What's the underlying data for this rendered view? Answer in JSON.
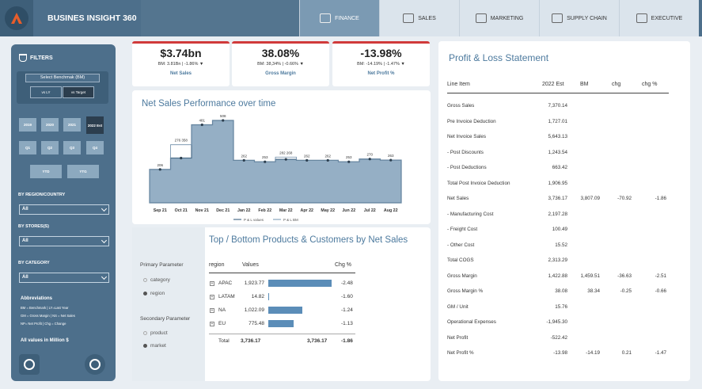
{
  "app": {
    "title": "BUSINES INSIGHT 360"
  },
  "nav": [
    {
      "label": "FINANCE",
      "icon": "finance-icon",
      "active": true
    },
    {
      "label": "SALES",
      "icon": "sales-icon",
      "active": false
    },
    {
      "label": "MARKETING",
      "icon": "marketing-icon",
      "active": false
    },
    {
      "label": "SUPPLY CHAIN",
      "icon": "supply-chain-icon",
      "active": false
    },
    {
      "label": "EXECUTIVE",
      "icon": "executive-icon",
      "active": false
    }
  ],
  "sidebar": {
    "filters_label": "FILTERS",
    "benchmark_title": "Select Benchmak (BM)",
    "bm_options": [
      "vs LY",
      "vs Target"
    ],
    "bm_selected": "vs Target",
    "years": [
      "2019",
      "2020",
      "2021",
      "2022 Est"
    ],
    "year_selected": "2022 Est",
    "quarters": [
      "Q1",
      "Q2",
      "Q3",
      "Q4"
    ],
    "to_date": [
      "YTD",
      "YTG"
    ],
    "region_label": "BY REGION/COUNTRY",
    "region_value": "All",
    "stores_label": "BY STORES(S)",
    "stores_value": "All",
    "category_label": "BY CATEGORY",
    "category_value": "All",
    "abbr_title": "Abbreviations",
    "abbr_lines": [
      "BM = Benchmark | LY=Last Year",
      "GM = Gross Margin | NS = Net Sales",
      "NP= Net Profit | Chg = Change"
    ],
    "all_values": "All values in Million $"
  },
  "kpis": [
    {
      "value": "$3.74bn",
      "bm": "BM: 3.81Bn | -1.86% ▼",
      "label": "Net Sales"
    },
    {
      "value": "38.08%",
      "bm": "BM: 38,34% | -0.66% ▼",
      "label": "Gross Margin"
    },
    {
      "value": "-13.98%",
      "bm": "BM: -14.19% | -1.47% ▼",
      "label": "Net Profit %"
    }
  ],
  "net_sales_chart": {
    "title": "Net Sales Performance over time",
    "legend": [
      "P & L values",
      "P & L BM"
    ]
  },
  "chart_data": {
    "type": "area",
    "categories": [
      "Sep 21",
      "Oct 21",
      "Nov 21",
      "Dec 21",
      "Jan 22",
      "Feb 22",
      "Mar 22",
      "Apr 22",
      "May 22",
      "Jun 22",
      "Jul 22",
      "Aug 22"
    ],
    "series": [
      {
        "name": "P & L values",
        "values": [
          206,
          276,
          481,
          508,
          262,
          253,
          268,
          262,
          262,
          253,
          270,
          263
        ]
      },
      {
        "name": "P & L BM",
        "values": [
          206,
          358,
          481,
          508,
          262,
          253,
          282,
          262,
          262,
          253,
          270,
          263
        ]
      }
    ],
    "data_labels": [
      "206",
      "276 358",
      "481",
      "508",
      "262",
      "253",
      "282 268",
      "262",
      "262",
      "253",
      "270",
      "263"
    ]
  },
  "top_bottom": {
    "title": "Top / Bottom Products & Customers by Net Sales",
    "primary_label": "Primary Parameter",
    "primary_options": [
      "category",
      "region"
    ],
    "primary_selected": "region",
    "secondary_label": "Secondary Parameter",
    "secondary_options": [
      "product",
      "market"
    ],
    "secondary_selected": "market",
    "col_region": "region",
    "col_values": "Values",
    "col_chg": "Chg %",
    "rows": [
      {
        "name": "APAC",
        "value": "1,923.77",
        "bar": 1923.77,
        "chg": "-2.48"
      },
      {
        "name": "LATAM",
        "value": "14.82",
        "bar": 14.82,
        "chg": "-1.60"
      },
      {
        "name": "NA",
        "value": "1,022.09",
        "bar": 1022.09,
        "chg": "-1.24"
      },
      {
        "name": "EU",
        "value": "775.48",
        "bar": 775.48,
        "chg": "-1.13"
      }
    ],
    "total_label": "Total",
    "total_value": "3,736.17",
    "total_value2": "3,736.17",
    "total_chg": "-1.86"
  },
  "pl": {
    "title": "Profit & Loss Statement",
    "headers": [
      "Line Item",
      "2022 Est",
      "BM",
      "chg",
      "chg %"
    ],
    "rows": [
      {
        "item": "Gross Sales",
        "est": "7,370.14",
        "bm": "",
        "chg": "",
        "chgp": ""
      },
      {
        "item": "Pre Invoice Deduction",
        "est": "1,727.01",
        "bm": "",
        "chg": "",
        "chgp": ""
      },
      {
        "item": "Net Invoice Sales",
        "est": "5,643.13",
        "bm": "",
        "chg": "",
        "chgp": ""
      },
      {
        "item": "- Post Discounts",
        "est": "1,243.54",
        "bm": "",
        "chg": "",
        "chgp": ""
      },
      {
        "item": "- Post Deductions",
        "est": "663.42",
        "bm": "",
        "chg": "",
        "chgp": ""
      },
      {
        "item": "Total Post Invoice Deduction",
        "est": "1,906.95",
        "bm": "",
        "chg": "",
        "chgp": ""
      },
      {
        "item": "Net Sales",
        "est": "3,736.17",
        "bm": "3,807.09",
        "chg": "-70.92",
        "chgp": "-1.86"
      },
      {
        "item": "- Manufacturing Cost",
        "est": "2,197.28",
        "bm": "",
        "chg": "",
        "chgp": ""
      },
      {
        "item": "- Freight Cost",
        "est": "100.49",
        "bm": "",
        "chg": "",
        "chgp": ""
      },
      {
        "item": "- Other Cost",
        "est": "15.52",
        "bm": "",
        "chg": "",
        "chgp": ""
      },
      {
        "item": "Total COGS",
        "est": "2,313.29",
        "bm": "",
        "chg": "",
        "chgp": ""
      },
      {
        "item": "Gross Margin",
        "est": "1,422.88",
        "bm": "1,459.51",
        "chg": "-36.63",
        "chgp": "-2.51"
      },
      {
        "item": "Gross Margin %",
        "est": "38.08",
        "bm": "38.34",
        "chg": "-0.25",
        "chgp": "-0.66"
      },
      {
        "item": "GM / Unit",
        "est": "15.76",
        "bm": "",
        "chg": "",
        "chgp": ""
      },
      {
        "item": "Operational Expenses",
        "est": "-1,945.30",
        "bm": "",
        "chg": "",
        "chgp": ""
      },
      {
        "item": "Net Profit",
        "est": "-522.42",
        "bm": "",
        "chg": "",
        "chgp": ""
      },
      {
        "item": "Net Profit %",
        "est": "-13.98",
        "bm": "-14.19",
        "chg": "0.21",
        "chgp": "-1.47"
      }
    ]
  }
}
